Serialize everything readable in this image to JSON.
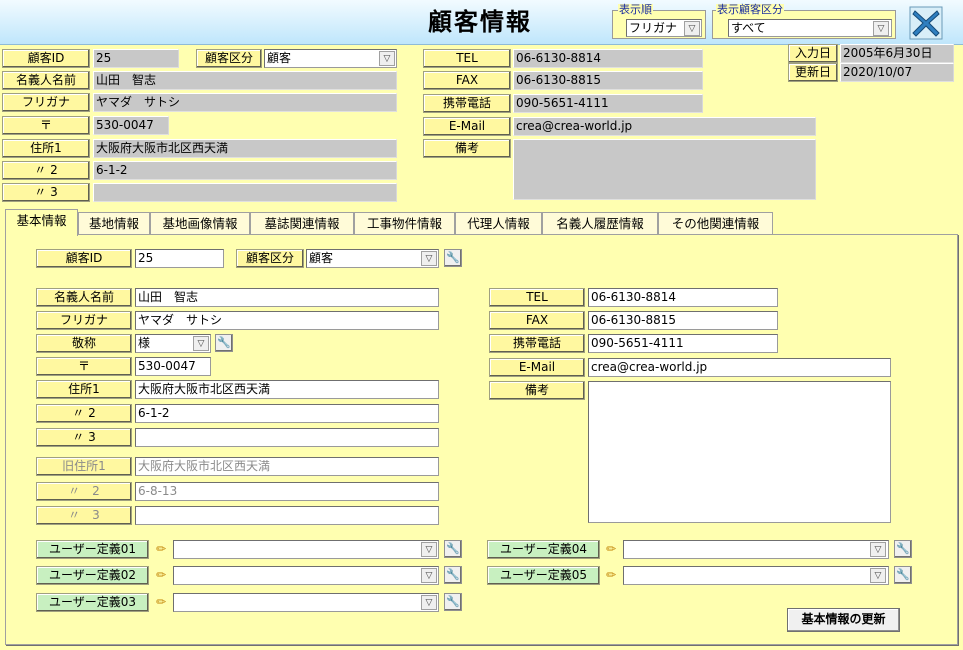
{
  "header": {
    "title": "顧客情報",
    "sort_group_label": "表示順",
    "sort_value": "フリガナ",
    "category_group_label": "表示顧客区分",
    "category_value": "すべて",
    "close_icon": "close-x-icon"
  },
  "top": {
    "customer_id": {
      "label": "顧客ID",
      "value": "25"
    },
    "customer_type": {
      "label": "顧客区分",
      "value": "顧客"
    },
    "name": {
      "label": "名義人名前",
      "value": "山田　智志"
    },
    "furigana": {
      "label": "フリガナ",
      "value": "ヤマダ　サトシ"
    },
    "postal": {
      "label": "〒",
      "value": "530-0047"
    },
    "address1": {
      "label": "住所1",
      "value": "大阪府大阪市北区西天満"
    },
    "address2": {
      "label": "〃 2",
      "value": "6-1-2"
    },
    "address3": {
      "label": "〃 3",
      "value": ""
    },
    "tel": {
      "label": "TEL",
      "value": "06-6130-8814"
    },
    "fax": {
      "label": "FAX",
      "value": "06-6130-8815"
    },
    "mobile": {
      "label": "携帯電話",
      "value": "090-5651-4111"
    },
    "email": {
      "label": "E-Mail",
      "value": "crea@crea-world.jp"
    },
    "notes": {
      "label": "備考",
      "value": ""
    },
    "entry_date": {
      "label": "入力日",
      "value": "2005年6月30日"
    },
    "update_date": {
      "label": "更新日",
      "value": "2020/10/07"
    }
  },
  "tabs": [
    {
      "label": "基本情報"
    },
    {
      "label": "基地情報"
    },
    {
      "label": "基地画像情報"
    },
    {
      "label": "墓誌関連情報"
    },
    {
      "label": "工事物件情報"
    },
    {
      "label": "代理人情報"
    },
    {
      "label": "名義人履歴情報"
    },
    {
      "label": "その他関連情報"
    }
  ],
  "form": {
    "customer_id": {
      "label": "顧客ID",
      "value": "25"
    },
    "customer_type": {
      "label": "顧客区分",
      "value": "顧客"
    },
    "name": {
      "label": "名義人名前",
      "value": "山田　智志"
    },
    "furigana": {
      "label": "フリガナ",
      "value": "ヤマダ　サトシ"
    },
    "honorific": {
      "label": "敬称",
      "value": "様"
    },
    "postal": {
      "label": "〒",
      "value": "530-0047"
    },
    "address1": {
      "label": "住所1",
      "value": "大阪府大阪市北区西天満"
    },
    "address2": {
      "label": "〃 2",
      "value": "6-1-2"
    },
    "address3": {
      "label": "〃 3",
      "value": ""
    },
    "old_address1": {
      "label": "旧住所1",
      "value": "大阪府大阪市北区西天満"
    },
    "old_address2": {
      "label": "〃　2",
      "value": "6-8-13"
    },
    "old_address3": {
      "label": "〃　3",
      "value": ""
    },
    "tel": {
      "label": "TEL",
      "value": "06-6130-8814"
    },
    "fax": {
      "label": "FAX",
      "value": "06-6130-8815"
    },
    "mobile": {
      "label": "携帯電話",
      "value": "090-5651-4111"
    },
    "email": {
      "label": "E-Mail",
      "value": "crea@crea-world.jp"
    },
    "notes": {
      "label": "備考",
      "value": ""
    },
    "user_defs": [
      {
        "label": "ユーザー定義01",
        "value": ""
      },
      {
        "label": "ユーザー定義02",
        "value": ""
      },
      {
        "label": "ユーザー定義03",
        "value": ""
      },
      {
        "label": "ユーザー定義04",
        "value": ""
      },
      {
        "label": "ユーザー定義05",
        "value": ""
      }
    ],
    "update_button": "基本情報の更新"
  }
}
